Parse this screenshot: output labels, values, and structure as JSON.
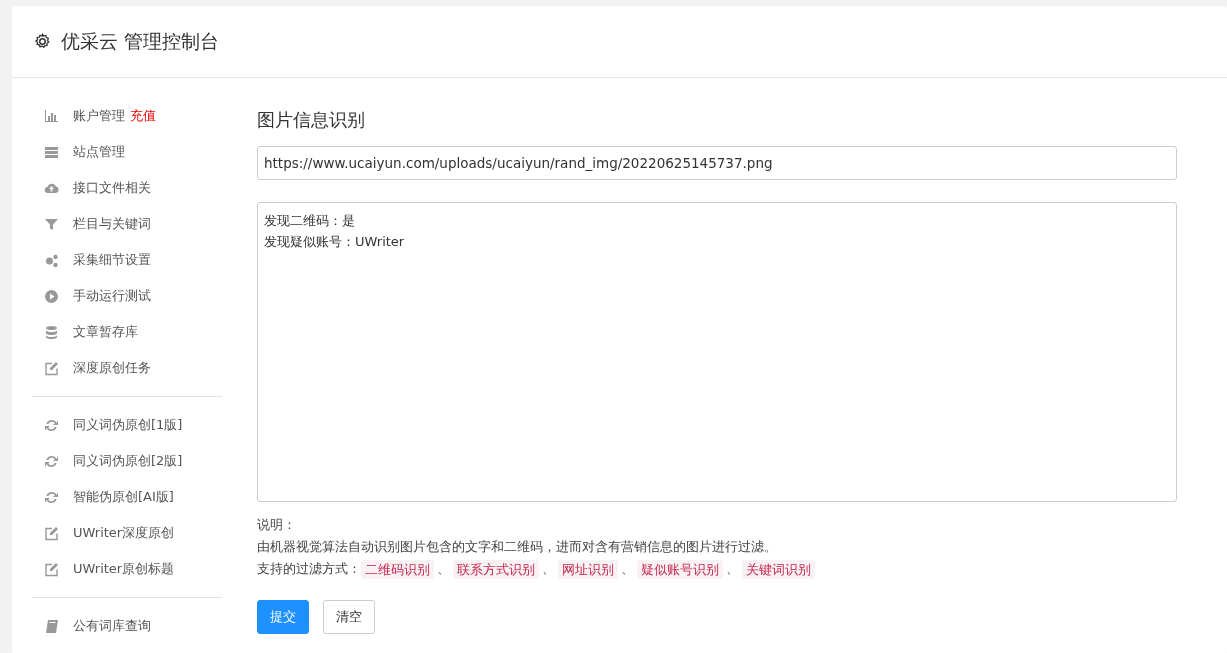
{
  "header": {
    "title": "优采云 管理控制台"
  },
  "sidebar": {
    "groups": [
      [
        {
          "label": "账户管理",
          "badge": "充值"
        },
        {
          "label": "站点管理"
        },
        {
          "label": "接口文件相关"
        },
        {
          "label": "栏目与关键词"
        },
        {
          "label": "采集细节设置"
        },
        {
          "label": "手动运行测试"
        },
        {
          "label": "文章暂存库"
        },
        {
          "label": "深度原创任务"
        }
      ],
      [
        {
          "label": "同义词伪原创[1版]"
        },
        {
          "label": "同义词伪原创[2版]"
        },
        {
          "label": "智能伪原创[AI版]"
        },
        {
          "label": "UWriter深度原创"
        },
        {
          "label": "UWriter原创标题"
        }
      ],
      [
        {
          "label": "公有词库查询"
        }
      ]
    ]
  },
  "main": {
    "title": "图片信息识别",
    "url_field": {
      "value": "https://www.ucaiyun.com/uploads/ucaiyun/rand_img/20220625145737.png"
    },
    "result_lines": [
      "发现二维码：是",
      "发现疑似账号：UWriter"
    ],
    "notes_heading": "说明：",
    "description": "由机器视觉算法自动识别图片包含的文字和二维码，进而对含有营销信息的图片进行过滤。",
    "filter_label": "支持的过滤方式：",
    "filter_tags": [
      {
        "label": "二维码识别",
        "separator": "、"
      },
      {
        "label": "联系方式识别",
        "separator": "、"
      },
      {
        "label": "网址识别",
        "separator": "、"
      },
      {
        "label": "疑似账号识别",
        "separator": "、"
      },
      {
        "label": "关键词识别"
      }
    ],
    "buttons": [
      {
        "label": "提交",
        "kind": "primary"
      },
      {
        "label": "清空",
        "kind": "default"
      }
    ]
  }
}
